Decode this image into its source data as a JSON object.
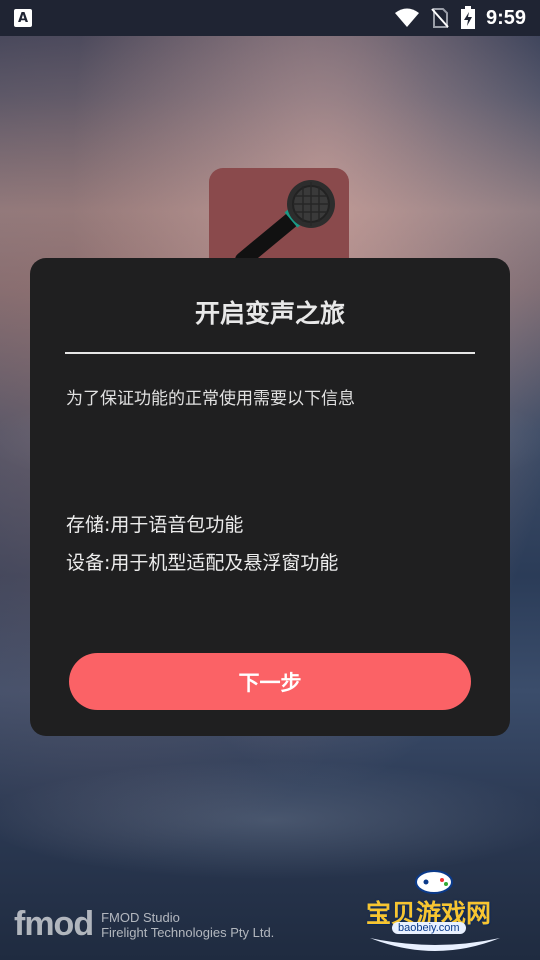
{
  "status_bar": {
    "notification_icon": "A",
    "time": "9:59",
    "icons": [
      "wifi-icon",
      "no-sim-icon",
      "battery-charging-icon"
    ]
  },
  "dialog": {
    "title": "开启变声之旅",
    "intro": "为了保证功能的正常使用需要以下信息",
    "permissions": [
      "存储:用于语音包功能",
      "设备:用于机型适配及悬浮窗功能"
    ],
    "next_button": "下一步"
  },
  "footer": {
    "fmod_logo": "fmod",
    "fmod_line1": "FMOD Studio",
    "fmod_line2": "Firelight Technologies Pty Ltd.",
    "watermark_title": "宝贝游戏网",
    "watermark_url": "baobeiy.com"
  },
  "colors": {
    "dialog_bg": "#1f1f20",
    "button": "#fb6266",
    "app_icon_bg": "#8a4a4c"
  }
}
